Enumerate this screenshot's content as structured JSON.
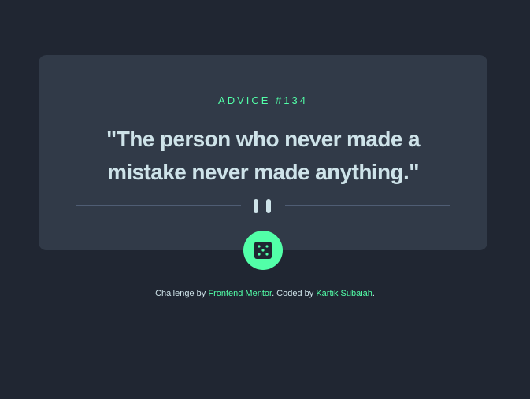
{
  "card": {
    "advice_label": "ADVICE #134",
    "quote": "\"The person who never made a mistake never made anything.\""
  },
  "icons": {
    "divider": "pause-icon",
    "button": "dice-icon"
  },
  "footer": {
    "prefix": "Challenge by ",
    "link1": "Frontend Mentor",
    "middle": ". Coded by ",
    "link2": "Kartik Subaiah",
    "suffix": "."
  },
  "colors": {
    "background": "#202632",
    "card": "#313a48",
    "accent": "#52ffa8",
    "text": "#cee3e9",
    "divider": "#4f5d74"
  }
}
